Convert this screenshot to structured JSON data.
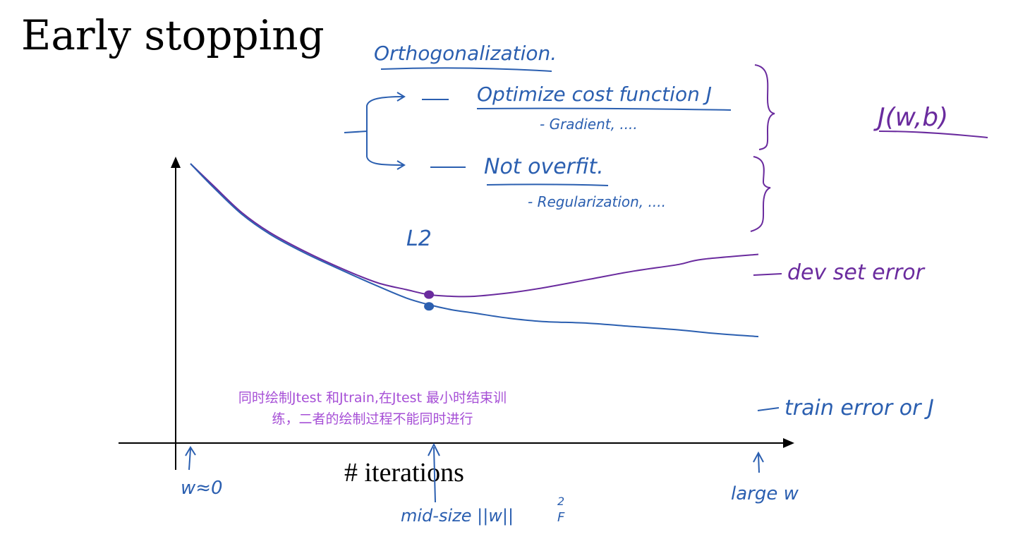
{
  "title": "Early stopping",
  "xlabel": "# iterations",
  "colors": {
    "blue": "#2b5fb0",
    "purple": "#6a2b9e",
    "note": "#a64fd6",
    "axis": "#000000"
  },
  "annotations": {
    "orthogonalization": "Orthogonalization.",
    "optimize": "Optimize cost function J",
    "gradient": "- Gradient, ....",
    "not_overfit": "Not overfit.",
    "regularization": "- Regularization, ....",
    "l2": "L2",
    "jwb": "J(w,b)",
    "w_zero": "w≈0",
    "mid_size": "mid-size ||w||",
    "mid_size_sub": "F",
    "mid_size_sup": "2",
    "large_w": "large w"
  },
  "note": {
    "line1": "同时绘制Jtest 和Jtrain,在Jtest 最小时结束训",
    "line2": "练，二者的绘制过程不能同时进行"
  },
  "chart_data": {
    "type": "line",
    "x_range": [
      0,
      100
    ],
    "y_range": [
      0,
      100
    ],
    "grid": false,
    "series": [
      {
        "name": "dev set error",
        "color": "#6a2b9e",
        "x": [
          0,
          4,
          9,
          14,
          20,
          27,
          33,
          38,
          42,
          46,
          50,
          56,
          62,
          70,
          78,
          86,
          90,
          100
        ],
        "y": [
          100,
          87,
          71,
          59,
          48,
          37,
          29,
          25,
          22,
          21,
          21,
          23,
          26,
          31,
          36,
          40,
          43,
          46
        ]
      },
      {
        "name": "train error or J",
        "color": "#2b5fb0",
        "x": [
          0,
          4,
          9,
          14,
          20,
          27,
          33,
          38,
          42,
          46,
          50,
          56,
          62,
          70,
          78,
          86,
          92,
          100
        ],
        "y": [
          100,
          86,
          70,
          58,
          47,
          36,
          27,
          20,
          16,
          13,
          11,
          8,
          6,
          5,
          3,
          1,
          -1,
          -3
        ]
      }
    ],
    "markers": [
      {
        "series": "dev set error",
        "x": 42,
        "y": 22
      },
      {
        "series": "train error or J",
        "x": 42,
        "y": 15
      }
    ]
  }
}
